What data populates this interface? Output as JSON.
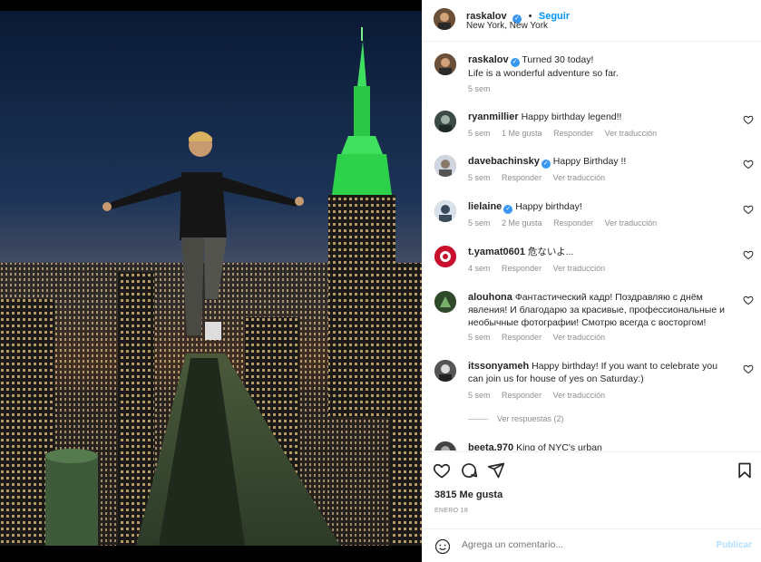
{
  "post": {
    "author": "raskalov",
    "follow_label": "Seguir",
    "separator": "•",
    "location": "New York, New York"
  },
  "caption": {
    "username": "raskalov",
    "text": "Turned 30 today!",
    "text2": "Life is a wonderful adventure so far.",
    "time": "5 sem"
  },
  "comments": [
    {
      "username": "ryanmillier",
      "verified": false,
      "text": "Happy birthday legend!!",
      "time": "5 sem",
      "likes": "1 Me gusta",
      "reply": "Responder",
      "translate": "Ver traducción"
    },
    {
      "username": "davebachinsky",
      "verified": true,
      "text": "Happy Birthday !!",
      "time": "5 sem",
      "likes": "",
      "reply": "Responder",
      "translate": "Ver traducción"
    },
    {
      "username": "lielaine",
      "verified": true,
      "text": "Happy birthday!",
      "time": "5 sem",
      "likes": "2 Me gusta",
      "reply": "Responder",
      "translate": "Ver traducción"
    },
    {
      "username": "t.yamat0601",
      "verified": false,
      "text": "危ないよ...",
      "time": "4 sem",
      "likes": "",
      "reply": "Responder",
      "translate": "Ver traducción"
    },
    {
      "username": "alouhona",
      "verified": false,
      "text": "Фантастический кадр! Поздравляю с днём явления! И благодарю за красивые, профессиональные и необычные фотографии! Смотрю всегда с восторгом!",
      "time": "5 sem",
      "likes": "",
      "reply": "Responder",
      "translate": "Ver traducción"
    },
    {
      "username": "itssonyameh",
      "verified": false,
      "text": "Happy birthday! If you want to celebrate you can join us for house of yes on Saturday:)",
      "time": "5 sem",
      "likes": "",
      "reply": "Responder",
      "translate": "Ver traducción"
    },
    {
      "username": "beeta.970",
      "verified": false,
      "text": "King of NYC's urban",
      "time": "",
      "likes": "",
      "reply": "",
      "translate": ""
    }
  ],
  "view_replies": "Ver respuestas (2)",
  "likes_count": "3815 Me gusta",
  "date": "ENERO 18",
  "add_comment": {
    "placeholder": "Agrega un comentario...",
    "publish": "Publicar"
  },
  "icons": {
    "like": "heart-icon",
    "comment": "comment-icon",
    "share": "share-icon",
    "save": "bookmark-icon",
    "emoji": "emoji-icon",
    "verified": "verified-badge-icon"
  },
  "colors": {
    "accent": "#0095f6",
    "verified": "#3897f0",
    "muted": "#8e8e8e",
    "building_green": "#2ed14a"
  }
}
